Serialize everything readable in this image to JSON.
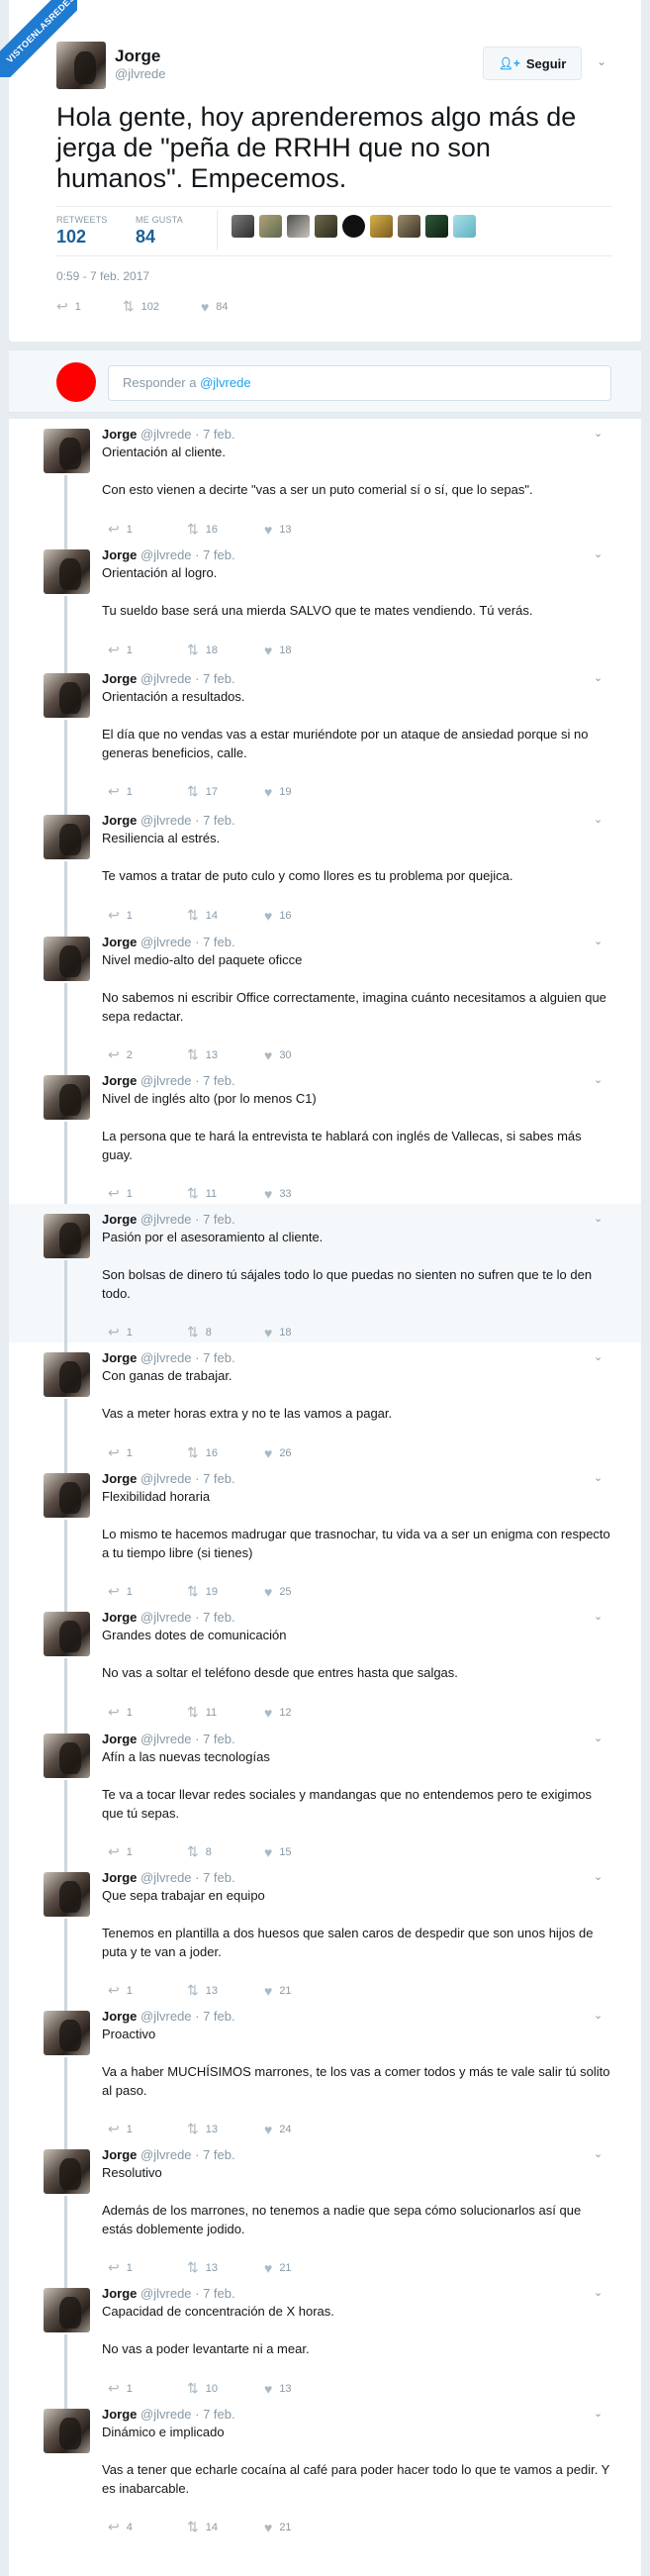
{
  "watermark": "VISTOENLASREDES",
  "main": {
    "name": "Jorge",
    "handle": "@jlvrede",
    "follow_label": "Seguir",
    "text": "Hola gente, hoy aprenderemos algo más de jerga de \"peña de RRHH que no son humanos\". Empecemos.",
    "retweets_label": "RETWEETS",
    "retweets_value": "102",
    "likes_label": "ME GUSTA",
    "likes_value": "84",
    "date": "0:59 - 7 feb. 2017",
    "reply_count": "1",
    "retweet_count": "102",
    "like_count": "84"
  },
  "reply": {
    "prefix": "Responder a ",
    "handle": "@jlvrede"
  },
  "tweets": [
    {
      "name": "Jorge",
      "meta": "@jlvrede · 7 feb.",
      "title": "Orientación al cliente.",
      "body": "Con esto vienen a decirte \"vas a ser un puto comerial sí o sí, que lo sepas\".",
      "replies": "1",
      "retweets": "16",
      "likes": "13"
    },
    {
      "name": "Jorge",
      "meta": "@jlvrede · 7 feb.",
      "title": "Orientación al logro.",
      "body": "Tu sueldo base será una mierda SALVO que te mates vendiendo. Tú verás.",
      "replies": "1",
      "retweets": "18",
      "likes": "18"
    },
    {
      "name": "Jorge",
      "meta": "@jlvrede · 7 feb.",
      "title": "Orientación a resultados.",
      "body": "El día que no vendas vas a estar muriéndote por un ataque de ansiedad porque si no generas beneficios, calle.",
      "replies": "1",
      "retweets": "17",
      "likes": "19"
    },
    {
      "name": "Jorge",
      "meta": "@jlvrede · 7 feb.",
      "title": "Resiliencia al estrés.",
      "body": "Te vamos a tratar de puto culo y como llores es tu problema por quejica.",
      "replies": "1",
      "retweets": "14",
      "likes": "16"
    },
    {
      "name": "Jorge",
      "meta": "@jlvrede · 7 feb.",
      "title": "Nivel medio-alto del paquete oficce",
      "body": "No sabemos ni escribir Office correctamente, imagina cuánto necesitamos a alguien que sepa redactar.",
      "replies": "2",
      "retweets": "13",
      "likes": "30"
    },
    {
      "name": "Jorge",
      "meta": "@jlvrede · 7 feb.",
      "title": "Nivel de inglés alto (por lo menos C1)",
      "body": "La persona que te hará la entrevista te hablará con inglés de Vallecas, si sabes más guay.",
      "replies": "1",
      "retweets": "11",
      "likes": "33"
    },
    {
      "name": "Jorge",
      "meta": "@jlvrede · 7 feb.",
      "title": "Pasión por el asesoramiento al cliente.",
      "body": "Son bolsas de dinero tú sájales todo lo que puedas no sienten no sufren que te lo den todo.",
      "replies": "1",
      "retweets": "8",
      "likes": "18"
    },
    {
      "name": "Jorge",
      "meta": "@jlvrede · 7 feb.",
      "title": "Con ganas de trabajar.",
      "body": "Vas a meter horas extra y no te las vamos a pagar.",
      "replies": "1",
      "retweets": "16",
      "likes": "26"
    },
    {
      "name": "Jorge",
      "meta": "@jlvrede · 7 feb.",
      "title": "Flexibilidad horaria",
      "body": "Lo mismo te hacemos madrugar que trasnochar, tu vida va a ser un enigma con respecto a tu tiempo libre (si tienes)",
      "replies": "1",
      "retweets": "19",
      "likes": "25"
    },
    {
      "name": "Jorge",
      "meta": "@jlvrede · 7 feb.",
      "title": "Grandes dotes de comunicación",
      "body": "No vas a soltar el teléfono desde que entres hasta que salgas.",
      "replies": "1",
      "retweets": "11",
      "likes": "12"
    },
    {
      "name": "Jorge",
      "meta": "@jlvrede · 7 feb.",
      "title": "Afín a las nuevas tecnologías",
      "body": "Te va a tocar llevar redes sociales y mandangas que no entendemos pero te exigimos que tú sepas.",
      "replies": "1",
      "retweets": "8",
      "likes": "15"
    },
    {
      "name": "Jorge",
      "meta": "@jlvrede · 7 feb.",
      "title": "Que sepa trabajar en equipo",
      "body": "Tenemos en plantilla a dos huesos que salen caros de despedir que son unos hijos de puta y te van a joder.",
      "replies": "1",
      "retweets": "13",
      "likes": "21"
    },
    {
      "name": "Jorge",
      "meta": "@jlvrede · 7 feb.",
      "title": "Proactivo",
      "body": "Va a haber MUCHÍSIMOS marrones, te los vas a comer todos y más te vale salir tú solito al paso.",
      "replies": "1",
      "retweets": "13",
      "likes": "24"
    },
    {
      "name": "Jorge",
      "meta": "@jlvrede · 7 feb.",
      "title": "Resolutivo",
      "body": "Además de los marrones, no tenemos a nadie que sepa cómo solucionarlos así que estás doblemente jodido.",
      "replies": "1",
      "retweets": "13",
      "likes": "21"
    },
    {
      "name": "Jorge",
      "meta": "@jlvrede · 7 feb.",
      "title": "Capacidad de concentración de X horas.",
      "body": "No vas a poder levantarte ni a mear.",
      "replies": "1",
      "retweets": "10",
      "likes": "13"
    },
    {
      "name": "Jorge",
      "meta": "@jlvrede · 7 feb.",
      "title": "Dinámico e implicado",
      "body": "Vas a tener que echarle cocaína al café para poder hacer todo lo que te vamos a pedir. Y es inabarcable.",
      "replies": "4",
      "retweets": "14",
      "likes": "21"
    }
  ]
}
